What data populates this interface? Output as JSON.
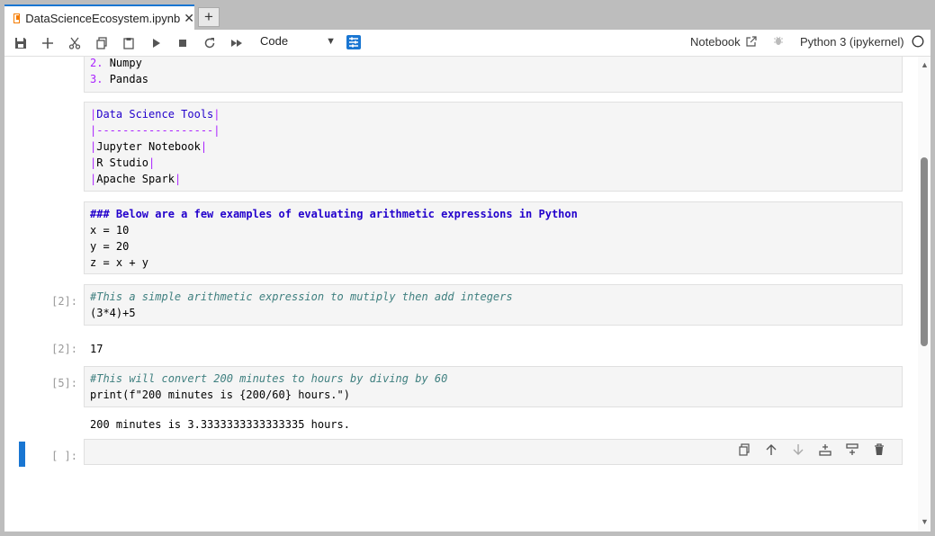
{
  "tab": {
    "title": "DataScienceEcosystem.ipynb",
    "close": "✕",
    "new": "+"
  },
  "toolbar": {
    "cell_type": "Code",
    "notebook_label": "Notebook",
    "kernel": "Python 3 (ipykernel)"
  },
  "cells": {
    "list_tail": [
      "2.",
      "Numpy",
      "3.",
      "Pandas"
    ],
    "table": {
      "header": "Data Science Tools",
      "separator": "------------------",
      "rows": [
        "Jupyter Notebook",
        "R Studio",
        "Apache Spark"
      ]
    },
    "arith_md": {
      "heading": "### Below are a few examples of evaluating arithmetic expressions in Python",
      "lines": [
        "x = 10",
        "y = 20",
        "z = x + y"
      ]
    },
    "code1": {
      "prompt": "[2]:",
      "comment": "#This a simple arithmetic expression to mutiply then add integers",
      "code": "(3*4)+5",
      "output_prompt": "[2]:",
      "output": "17"
    },
    "code2": {
      "prompt": "[5]:",
      "comment": "#This will convert 200 minutes to hours by diving by 60",
      "code": "print(f\"200 minutes is {200/60} hours.\")",
      "output": "200 minutes is 3.3333333333333335 hours."
    },
    "empty": {
      "prompt": "[ ]:"
    }
  },
  "colors": {
    "accent": "#1976d2",
    "tab_icon": "#f57c00"
  }
}
